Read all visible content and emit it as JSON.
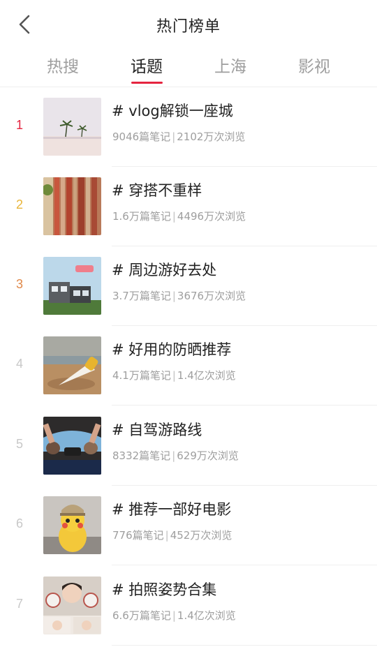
{
  "header": {
    "title": "热门榜单",
    "back_icon": "chevron-left-icon"
  },
  "tabs": [
    {
      "label": "热搜",
      "active": false
    },
    {
      "label": "话题",
      "active": true
    },
    {
      "label": "上海",
      "active": false
    },
    {
      "label": "影视",
      "active": false
    }
  ],
  "colors": {
    "accent": "#e5243f",
    "rank1": "#e5243f",
    "rank2": "#e9b53a",
    "rank3": "#e0894a",
    "rank_default": "#c8c8c8"
  },
  "items": [
    {
      "rank": "1",
      "topic": "# vlog解锁一座城",
      "notes": "9046篇笔记",
      "views": "2102万次浏览"
    },
    {
      "rank": "2",
      "topic": "# 穿搭不重样",
      "notes": "1.6万篇笔记",
      "views": "4496万次浏览"
    },
    {
      "rank": "3",
      "topic": "# 周边游好去处",
      "notes": "3.7万篇笔记",
      "views": "3676万次浏览"
    },
    {
      "rank": "4",
      "topic": "# 好用的防晒推荐",
      "notes": "4.1万篇笔记",
      "views": "1.4亿次浏览"
    },
    {
      "rank": "5",
      "topic": "# 自驾游路线",
      "notes": "8332篇笔记",
      "views": "629万次浏览"
    },
    {
      "rank": "6",
      "topic": "# 推荐一部好电影",
      "notes": "776篇笔记",
      "views": "452万次浏览"
    },
    {
      "rank": "7",
      "topic": "# 拍照姿势合集",
      "notes": "6.6万篇笔记",
      "views": "1.4亿次浏览"
    }
  ]
}
